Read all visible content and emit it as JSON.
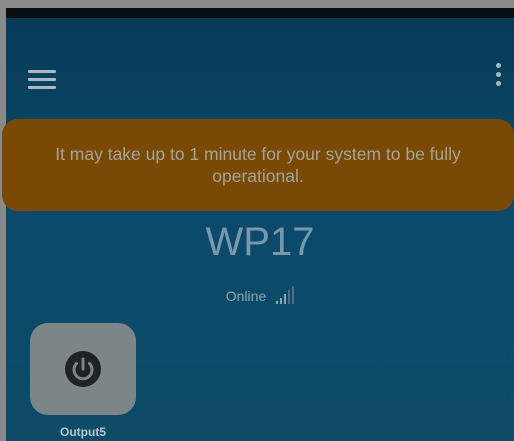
{
  "header": {
    "menu_icon": "hamburger-menu-icon",
    "more_icon": "more-vertical-icon"
  },
  "toast": {
    "message": "It may take up to 1 minute for your system to be fully operational."
  },
  "device": {
    "name": "WP17",
    "status": "Online",
    "signal_icon": "signal-strength-icon",
    "signal_bars_active": 3,
    "signal_bars_total": 5
  },
  "outputs": [
    {
      "label": "Output5",
      "icon": "power-icon"
    }
  ],
  "colors": {
    "background_top": "#063a57",
    "toast_background": "#7a4a05",
    "tile_background": "#7c8588"
  }
}
